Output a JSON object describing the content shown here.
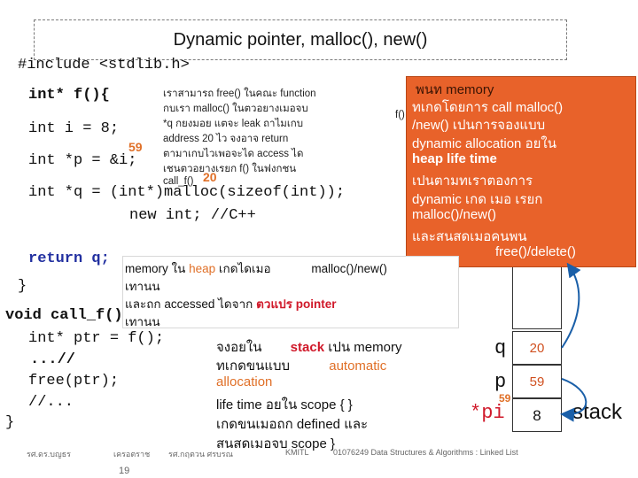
{
  "slide": {
    "title": "Dynamic pointer,   malloc(), new()",
    "page_number": "19"
  },
  "code": {
    "include": "#include <stdlib.h>",
    "fdecl": "int* f(){",
    "int_i": "int i = 8;",
    "int_p": "int *p = &i;",
    "int_q": "int *q = (int*)malloc(sizeof(int));",
    "new_int": "new int; //C++",
    "return_q": "return q;",
    "close_brace_1": "}",
    "call_f": "void call_f(){",
    "ptr_line": "int* ptr = f();",
    "dots": "...//",
    "free_line": "free(ptr);",
    "comment_line": "//...",
    "close_brace_2": "}"
  },
  "annotations": {
    "num_59_a": "59",
    "num_20": "20",
    "small_note": [
      "เราสามารถ free() ในคณะ function",
      "กบเรา      malloc() ในตวอยางเมอจบ",
      "*q กยงมอย        แตจะ  leak ถาไมเกบ",
      "address 20 ไว    จงอาจ    return",
      "ตามาเกบไวเพอจะได            access ได",
      "เชนตวอยางเรยก              f() ในฟงกชน",
      "call_f()"
    ],
    "small_note_f": "f()"
  },
  "red_box": {
    "lines": [
      "พนท                 memory",
      "ทเกดโดยการ            call malloc()",
      "/new() เปนการจองแบบ",
      "dynamic allocation อยใน",
      "heap life time",
      "เปนตามทเราตองการ",
      "dynamic เกด  เมอ       เรยก",
      "malloc()/new()",
      "และสนสดเมอคนพน",
      "free()/delete()"
    ]
  },
  "heap_note": {
    "l1_a": "memory ใน",
    "l1_b": "heap",
    "l1_c": "เกดไดเมอ",
    "l1_d": "malloc()/new()",
    "l2": "เทานน",
    "l3_a": "และถก  accessed ไดจาก",
    "l3_b": "ตวแปร  pointer",
    "l4": "เทานน"
  },
  "stack_note": {
    "l1_a": "จงอยใน",
    "l1_b": "stack",
    "l1_c": "เปน  memory",
    "l2_a": "ทเกดขนแบบ",
    "l2_b": "automatic",
    "l3": "allocation",
    "l4": "life time อยใน         scope { }",
    "l5": "เกดขนเมอถก               defined และ",
    "l6": "สนสดเมอจบ                  scope }"
  },
  "memory": {
    "q_label": "q",
    "q_value": "20",
    "p_label": "p",
    "p_value": "59",
    "i_label": "*pi",
    "i_addr": "59",
    "i_value": "8",
    "stack_label": "stack"
  },
  "footer": {
    "author1": "รศ.ดร.บญธร",
    "author2": "เครอตราช",
    "author3": "รศ.กฤตวน   ศรบรณ",
    "org": "KMITL",
    "course": "01076249 Data Structures & Algorithms : Linked List"
  },
  "colors": {
    "accent_orange": "#e8622a",
    "highlight_red": "#d0192a",
    "code_blue": "#2230a0"
  }
}
